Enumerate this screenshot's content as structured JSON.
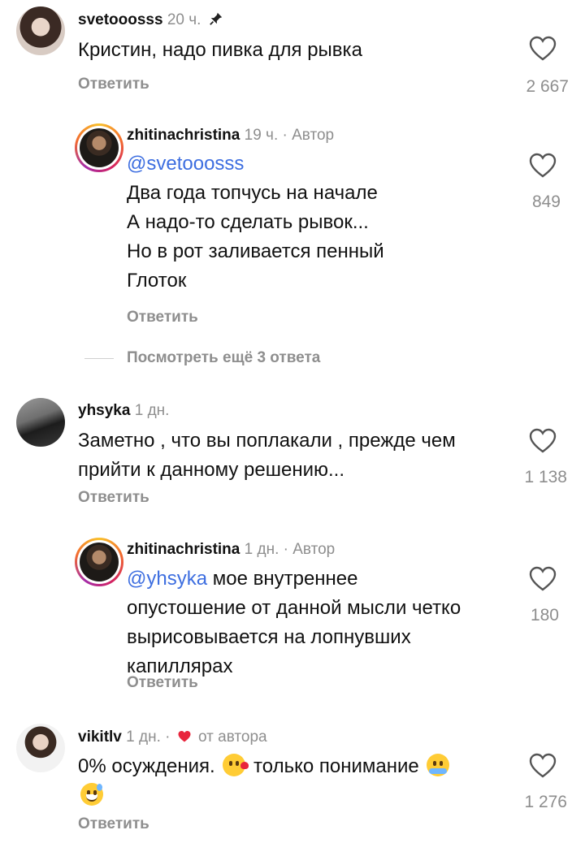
{
  "comments": [
    {
      "user": "svetooosss",
      "time": "20 ч.",
      "text": "Кристин, надо пивка для рывка",
      "reply_label": "Ответить",
      "likes": "2 667"
    },
    {
      "user": "zhitinachristina",
      "time": "19 ч.",
      "author_badge": "· Автор",
      "mention": "@svetooosss",
      "lines": [
        "Два года топчусь на начале",
        "А надо-то сделать рывок...",
        "Но в рот заливается пенный",
        "Глоток"
      ],
      "reply_label": "Ответить",
      "likes": "849"
    },
    {
      "view_more": "Посмотреть ещё 3 ответа"
    },
    {
      "user": "yhsyka",
      "time": "1 дн.",
      "lines": [
        "Заметно , что вы поплакали , прежде чем",
        "прийти к данному решению..."
      ],
      "reply_label": "Ответить",
      "likes": "1 138"
    },
    {
      "user": "zhitinachristina",
      "time": "1 дн.",
      "author_badge": "· Автор",
      "mention": "@yhsyka",
      "first_line_rest": " мое внутреннее",
      "lines": [
        "опустошение от данной мысли четко",
        "вырисовывается на лопнувших",
        "капиллярах"
      ],
      "reply_label": "Ответить",
      "likes": "180"
    },
    {
      "user": "vikitlv",
      "time": "1 дн. ·",
      "liked_by_author": "от автора",
      "text_a": "0% осуждения.",
      "text_b": "только понимание",
      "reply_label": "Ответить",
      "likes": "1 276"
    }
  ],
  "icons": {
    "heart": "heart-outline-icon",
    "pin": "pin-icon",
    "author_like": "red-heart-icon"
  },
  "colors": {
    "mention": "#3d6ee0",
    "secondary": "#8e8e8e",
    "author_heart": "#e8253c"
  }
}
